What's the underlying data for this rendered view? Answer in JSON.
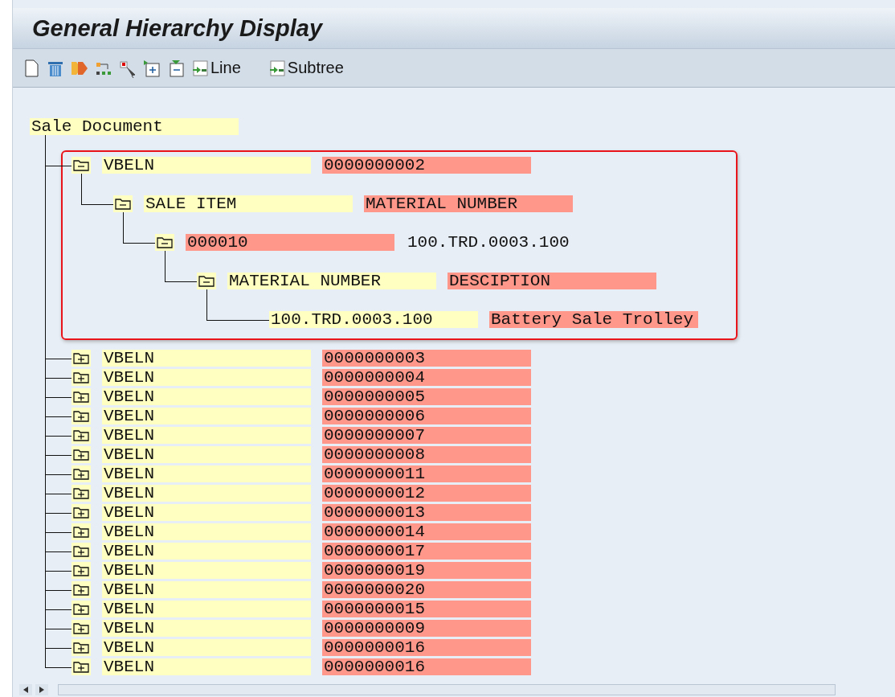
{
  "window": {
    "title": "General Hierarchy Display"
  },
  "toolbar": {
    "buttons": [
      {
        "label": "Line"
      },
      {
        "label": "Subtree"
      }
    ]
  },
  "tree": {
    "label": "Sale Document",
    "children": [
      {
        "kind": "folder",
        "expanded": true,
        "highlighted": true,
        "cells": [
          {
            "text": "VBELN",
            "kind": "label"
          },
          {
            "text": "0000000002",
            "kind": "value"
          }
        ],
        "children": [
          {
            "kind": "folder",
            "expanded": true,
            "cells": [
              {
                "text": "SALE ITEM",
                "kind": "label"
              },
              {
                "text": "MATERIAL NUMBER",
                "kind": "value"
              }
            ],
            "children": [
              {
                "kind": "folder",
                "expanded": true,
                "cells": [
                  {
                    "text": "000010",
                    "kind": "value"
                  },
                  {
                    "text": "100.TRD.0003.100",
                    "kind": "text"
                  }
                ],
                "children": [
                  {
                    "kind": "folder",
                    "expanded": true,
                    "cells": [
                      {
                        "text": "MATERIAL NUMBER",
                        "kind": "label"
                      },
                      {
                        "text": "DESCIPTION",
                        "kind": "value"
                      }
                    ],
                    "children": [
                      {
                        "kind": "leaf",
                        "cells": [
                          {
                            "text": "100.TRD.0003.100",
                            "kind": "label"
                          },
                          {
                            "text": "Battery Sale Trolley",
                            "kind": "value"
                          }
                        ]
                      }
                    ]
                  }
                ]
              }
            ]
          }
        ]
      },
      {
        "kind": "folder",
        "expanded": false,
        "highlighted": false,
        "cells": [
          {
            "text": "VBELN",
            "kind": "label"
          },
          {
            "text": "0000000003",
            "kind": "value"
          }
        ]
      },
      {
        "kind": "folder",
        "expanded": false,
        "highlighted": false,
        "cells": [
          {
            "text": "VBELN",
            "kind": "label"
          },
          {
            "text": "0000000004",
            "kind": "value"
          }
        ]
      },
      {
        "kind": "folder",
        "expanded": false,
        "highlighted": false,
        "cells": [
          {
            "text": "VBELN",
            "kind": "label"
          },
          {
            "text": "0000000005",
            "kind": "value"
          }
        ]
      },
      {
        "kind": "folder",
        "expanded": false,
        "highlighted": false,
        "cells": [
          {
            "text": "VBELN",
            "kind": "label"
          },
          {
            "text": "0000000006",
            "kind": "value"
          }
        ]
      },
      {
        "kind": "folder",
        "expanded": false,
        "highlighted": false,
        "cells": [
          {
            "text": "VBELN",
            "kind": "label"
          },
          {
            "text": "0000000007",
            "kind": "value"
          }
        ]
      },
      {
        "kind": "folder",
        "expanded": false,
        "highlighted": false,
        "cells": [
          {
            "text": "VBELN",
            "kind": "label"
          },
          {
            "text": "0000000008",
            "kind": "value"
          }
        ]
      },
      {
        "kind": "folder",
        "expanded": false,
        "highlighted": false,
        "cells": [
          {
            "text": "VBELN",
            "kind": "label"
          },
          {
            "text": "0000000011",
            "kind": "value"
          }
        ]
      },
      {
        "kind": "folder",
        "expanded": false,
        "highlighted": false,
        "cells": [
          {
            "text": "VBELN",
            "kind": "label"
          },
          {
            "text": "0000000012",
            "kind": "value"
          }
        ]
      },
      {
        "kind": "folder",
        "expanded": false,
        "highlighted": false,
        "cells": [
          {
            "text": "VBELN",
            "kind": "label"
          },
          {
            "text": "0000000013",
            "kind": "value"
          }
        ]
      },
      {
        "kind": "folder",
        "expanded": false,
        "highlighted": false,
        "cells": [
          {
            "text": "VBELN",
            "kind": "label"
          },
          {
            "text": "0000000014",
            "kind": "value"
          }
        ]
      },
      {
        "kind": "folder",
        "expanded": false,
        "highlighted": false,
        "cells": [
          {
            "text": "VBELN",
            "kind": "label"
          },
          {
            "text": "0000000017",
            "kind": "value"
          }
        ]
      },
      {
        "kind": "folder",
        "expanded": false,
        "highlighted": false,
        "cells": [
          {
            "text": "VBELN",
            "kind": "label"
          },
          {
            "text": "0000000019",
            "kind": "value"
          }
        ]
      },
      {
        "kind": "folder",
        "expanded": false,
        "highlighted": false,
        "cells": [
          {
            "text": "VBELN",
            "kind": "label"
          },
          {
            "text": "0000000020",
            "kind": "value"
          }
        ]
      },
      {
        "kind": "folder",
        "expanded": false,
        "highlighted": false,
        "cells": [
          {
            "text": "VBELN",
            "kind": "label"
          },
          {
            "text": "0000000015",
            "kind": "value"
          }
        ]
      },
      {
        "kind": "folder",
        "expanded": false,
        "highlighted": false,
        "cells": [
          {
            "text": "VBELN",
            "kind": "label"
          },
          {
            "text": "0000000009",
            "kind": "value"
          }
        ]
      },
      {
        "kind": "folder",
        "expanded": false,
        "highlighted": false,
        "cells": [
          {
            "text": "VBELN",
            "kind": "label"
          },
          {
            "text": "0000000016",
            "kind": "value"
          }
        ]
      },
      {
        "kind": "folder",
        "expanded": false,
        "highlighted": false,
        "cells": [
          {
            "text": "VBELN",
            "kind": "label"
          },
          {
            "text": "0000000016",
            "kind": "value"
          }
        ]
      }
    ]
  }
}
